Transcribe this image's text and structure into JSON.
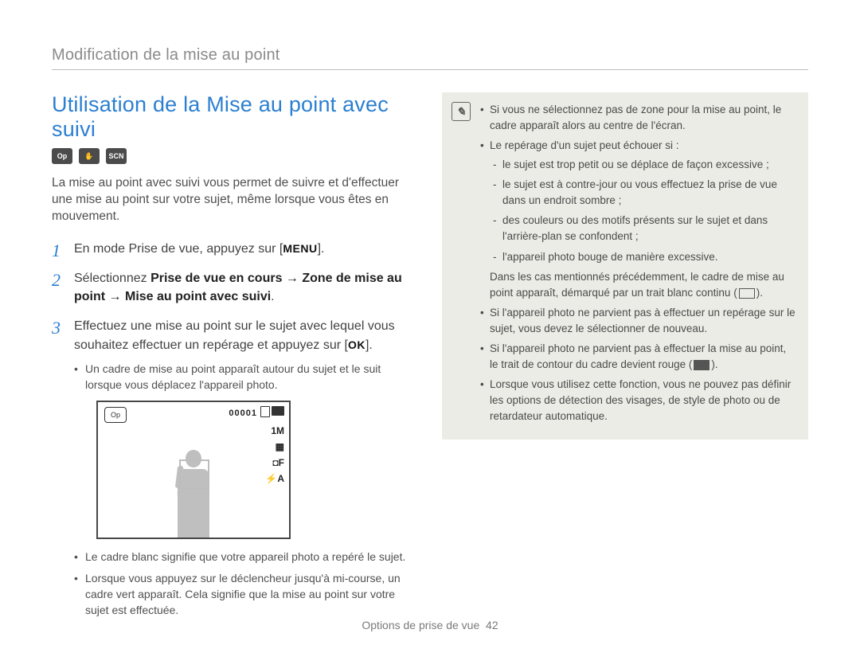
{
  "breadcrumb": "Modification de la mise au point",
  "title": "Utilisation de la Mise au point avec suivi",
  "mode_icons": [
    "Op",
    "✋",
    "SCN"
  ],
  "intro": "La mise au point avec suivi vous permet de suivre et d'effectuer une mise au point sur votre sujet, même lorsque vous êtes en mouvement.",
  "steps": {
    "s1_a": "En mode Prise de vue, appuyez sur [",
    "s1_btn": "MENU",
    "s1_b": "].",
    "s2_a": "Sélectionnez ",
    "s2_strong": "Prise de vue en cours → Zone de mise au point → Mise au point avec suivi",
    "s2_b": ".",
    "s3_a": "Effectuez une mise au point sur le sujet avec lequel vous souhaitez effectuer un repérage et appuyez sur [",
    "s3_btn": "OK",
    "s3_b": "]."
  },
  "step3_bullets": [
    "Un cadre de mise au point apparaît autour du sujet et le suit lorsque vous déplacez l'appareil photo."
  ],
  "camera": {
    "counter": "00001",
    "top_icon_label": "Op",
    "side": [
      "1M",
      "▦",
      "◘F",
      "⚡A"
    ]
  },
  "after_bullets": [
    "Le cadre blanc signifie que votre appareil photo a repéré le sujet.",
    "Lorsque vous appuyez sur le déclencheur jusqu'à mi-course, un cadre vert apparaît. Cela signifie que la mise au point sur votre sujet est effectuée."
  ],
  "note": {
    "b1": "Si vous ne sélectionnez pas de zone pour la mise au point, le cadre apparaît alors au centre de l'écran.",
    "b2": "Le repérage d'un sujet peut échouer si :",
    "b2_sub": [
      "le sujet est trop petit ou se déplace de façon excessive ;",
      "le sujet est à contre-jour ou vous effectuez la prise de vue dans un endroit sombre ;",
      "des couleurs ou des motifs présents sur le sujet et dans l'arrière-plan se confondent ;",
      "l'appareil photo bouge de manière excessive."
    ],
    "b2_post_a": "Dans les cas mentionnés précédemment, le cadre de mise au point apparaît, démarqué par un trait blanc continu (",
    "b2_post_b": ").",
    "b3": "Si l'appareil photo ne parvient pas à effectuer un repérage sur le sujet, vous devez le sélectionner de nouveau.",
    "b4_a": "Si l'appareil photo ne parvient pas à effectuer la mise au point, le trait de contour du cadre devient rouge (",
    "b4_b": ").",
    "b5": "Lorsque vous utilisez cette fonction, vous ne pouvez pas définir les options de détection des visages, de style de photo ou de retardateur automatique."
  },
  "footer_label": "Options de prise de vue",
  "footer_page": "42"
}
